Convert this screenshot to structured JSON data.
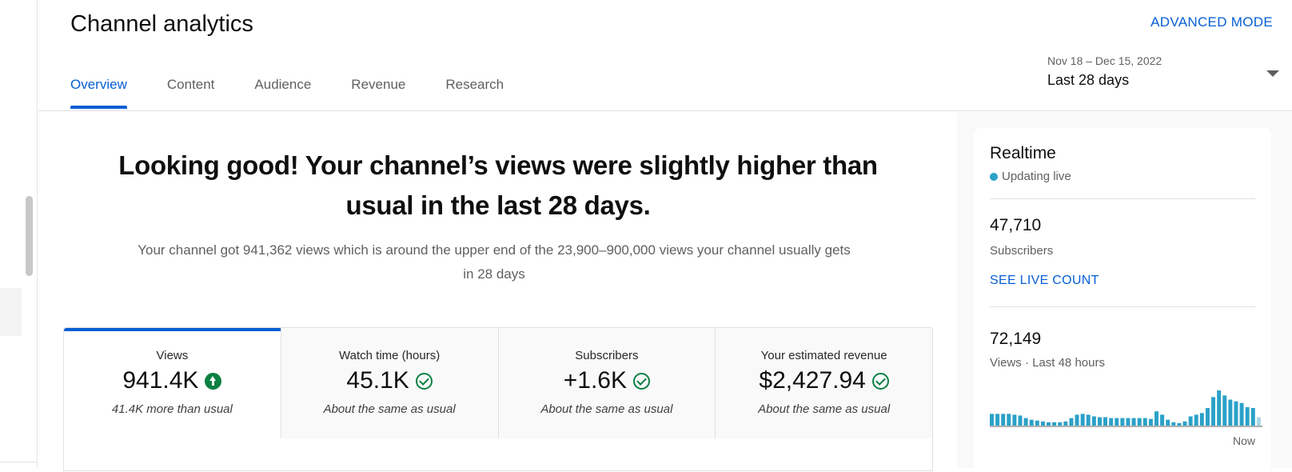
{
  "header": {
    "title": "Channel analytics",
    "advanced_mode": "ADVANCED MODE",
    "tabs": [
      {
        "label": "Overview",
        "active": true
      },
      {
        "label": "Content"
      },
      {
        "label": "Audience"
      },
      {
        "label": "Revenue"
      },
      {
        "label": "Research"
      }
    ],
    "date_range": "Nov 18 – Dec 15, 2022",
    "date_label": "Last 28 days"
  },
  "main": {
    "headline": "Looking good! Your channel’s views were slightly higher than usual in the last 28 days.",
    "summary": "Your channel got 941,362 views which is around the upper end of the 23,900–900,000 views your channel usually gets in 28 days"
  },
  "metrics": [
    {
      "name": "Views",
      "value": "941.4K",
      "note": "41.4K more than usual",
      "icon": "arrow-up-icon"
    },
    {
      "name": "Watch time (hours)",
      "value": "45.1K",
      "note": "About the same as usual",
      "icon": "check-circle-icon"
    },
    {
      "name": "Subscribers",
      "value": "+1.6K",
      "note": "About the same as usual",
      "icon": "check-circle-icon"
    },
    {
      "name": "Your estimated revenue",
      "value": "$2,427.94",
      "note": "About the same as usual",
      "icon": "check-circle-icon"
    }
  ],
  "realtime": {
    "title": "Realtime",
    "live_label": "Updating live",
    "subscribers_value": "47,710",
    "subscribers_label": "Subscribers",
    "see_live_count": "SEE LIVE COUNT",
    "views_value": "72,149",
    "views_label": "Views · Last 48 hours",
    "now_label": "Now",
    "bar_color": "#2ba1c8",
    "bars": [
      14,
      14,
      14,
      14,
      13,
      12,
      9,
      7,
      6,
      5,
      4,
      4,
      4,
      5,
      9,
      13,
      14,
      13,
      11,
      10,
      10,
      9,
      9,
      9,
      9,
      9,
      9,
      9,
      8,
      17,
      13,
      7,
      4,
      3,
      5,
      11,
      13,
      15,
      21,
      34,
      42,
      36,
      31,
      29,
      27,
      22,
      21,
      10
    ]
  },
  "colors": {
    "accent": "#065fd4",
    "success": "#0b8043"
  }
}
